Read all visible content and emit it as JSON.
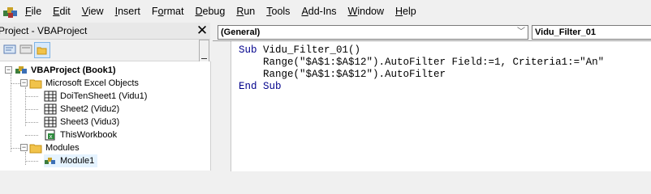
{
  "menubar": {
    "items": [
      {
        "label": "File",
        "u": 0
      },
      {
        "label": "Edit",
        "u": 0
      },
      {
        "label": "View",
        "u": 0
      },
      {
        "label": "Insert",
        "u": 0
      },
      {
        "label": "Format",
        "u": 1
      },
      {
        "label": "Debug",
        "u": 0
      },
      {
        "label": "Run",
        "u": 0
      },
      {
        "label": "Tools",
        "u": 0
      },
      {
        "label": "Add-Ins",
        "u": 0
      },
      {
        "label": "Window",
        "u": 0
      },
      {
        "label": "Help",
        "u": 0
      }
    ]
  },
  "project": {
    "title": "Project - VBAProject",
    "close": "✕",
    "tree": {
      "root": "VBAProject (Book1)",
      "excel_objects": "Microsoft Excel Objects",
      "sheets": [
        "DoiTenSheet1 (Vidu1)",
        "Sheet2 (Vidu2)",
        "Sheet3 (Vidu3)",
        "ThisWorkbook"
      ],
      "modules": "Modules",
      "module1": "Module1"
    }
  },
  "code": {
    "object_combo": "(General)",
    "proc_combo": "Vidu_Filter_01",
    "lines": [
      {
        "kw": "Sub",
        "rest": " Vidu_Filter_01()"
      },
      {
        "kw": "",
        "rest": "    Range(\"$A$1:$A$12\").AutoFilter Field:=1, Criteria1:=\"An\""
      },
      {
        "kw": "",
        "rest": "    Range(\"$A$1:$A$12\").AutoFilter"
      },
      {
        "kw": "End Sub",
        "rest": ""
      }
    ]
  },
  "colors": {
    "keyword": "#00008b",
    "selection": "#e5f3ff"
  }
}
